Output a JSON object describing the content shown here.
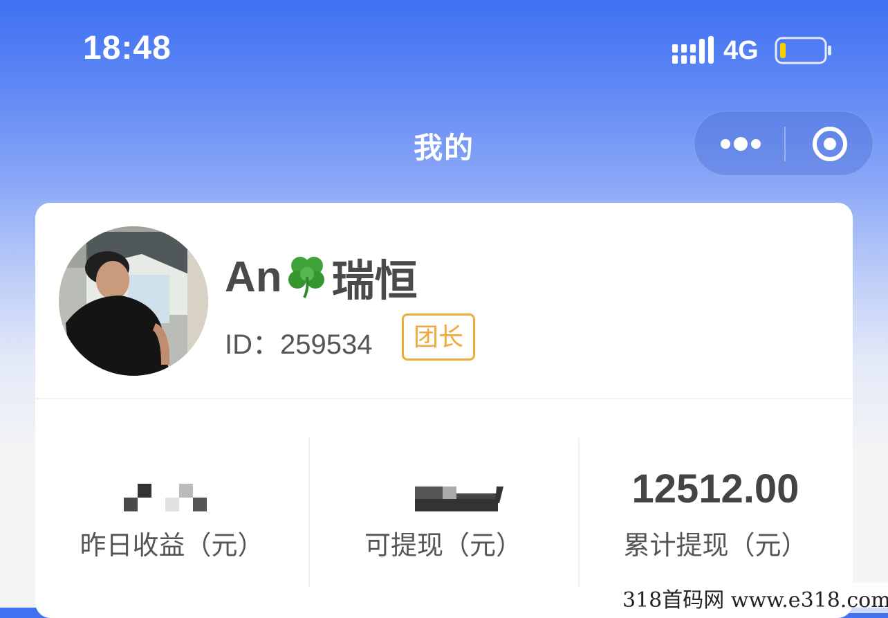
{
  "status_bar": {
    "time": "18:48",
    "network": "4G",
    "battery_icon": "battery-low-icon",
    "signal_icon": "signal-bars-icon"
  },
  "nav": {
    "title": "我的",
    "more_icon": "more-dots-icon",
    "close_icon": "target-circle-icon"
  },
  "profile": {
    "name_prefix": "An",
    "name_suffix": "瑞恒",
    "emoji_icon": "four-leaf-clover-icon",
    "id_label": "ID：",
    "id_value": "259534",
    "role_badge": "团长"
  },
  "stats": [
    {
      "label": "昨日收益（元）",
      "value": ""
    },
    {
      "label": "可提现（元）",
      "value": ""
    },
    {
      "label": "累计提现（元）",
      "value": "12512.00"
    }
  ],
  "watermark": "318首码网  www.e318.com",
  "colors": {
    "header_blue": "#3f70f2",
    "badge_orange": "#f0a93a",
    "text_dark": "#444444"
  }
}
